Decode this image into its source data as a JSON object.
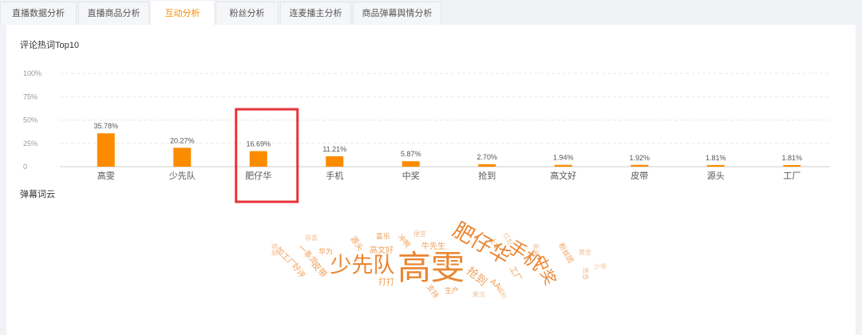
{
  "tabs": [
    {
      "label": "直播数据分析",
      "active": false
    },
    {
      "label": "直播商品分析",
      "active": false
    },
    {
      "label": "互动分析",
      "active": true
    },
    {
      "label": "粉丝分析",
      "active": false
    },
    {
      "label": "连麦播主分析",
      "active": false
    },
    {
      "label": "商品弹幕舆情分析",
      "active": false
    }
  ],
  "colors": {
    "accent": "#fb8c00",
    "active_tab_text": "#ff8a00",
    "highlight_box": "#e8333a",
    "page_background": "#f0f2f5",
    "panel_background": "#ffffff"
  },
  "chart_data": {
    "type": "bar",
    "title": "评论热词Top10",
    "categories": [
      "高雯",
      "少先队",
      "肥仔华",
      "手机",
      "中奖",
      "抢到",
      "高文好",
      "皮带",
      "源头",
      "工厂"
    ],
    "values": [
      35.78,
      20.27,
      16.69,
      11.21,
      5.87,
      2.7,
      1.94,
      1.92,
      1.81,
      1.81
    ],
    "value_labels": [
      "35.78%",
      "20.27%",
      "16.69%",
      "11.21%",
      "5.87%",
      "2.70%",
      "1.94%",
      "1.92%",
      "1.81%",
      "1.81%"
    ],
    "ylim": [
      0,
      100
    ],
    "ytick_values": [
      0,
      25,
      50,
      75,
      100
    ],
    "ytick_labels": [
      "0",
      "25%",
      "50%",
      "75%",
      "100%"
    ],
    "grid": true,
    "highlight_index": 2
  },
  "wordcloud": {
    "title": "弹幕词云",
    "words": [
      "高雯",
      "少先队",
      "肥仔华",
      "手机",
      "中奖",
      "抢到",
      "高文好",
      "皮带",
      "源头",
      "工厂",
      "恭喜",
      "华为",
      "好评",
      "加工厂",
      "一条龙",
      "辉哥",
      "喜乐",
      "冲啊",
      "便宜",
      "牛先生",
      "打打",
      "支持",
      "生产",
      "果冻",
      "福利",
      "AA",
      "上车",
      "红包",
      "画画",
      "粉丝团",
      "黄金",
      "真香",
      "少爷"
    ]
  }
}
